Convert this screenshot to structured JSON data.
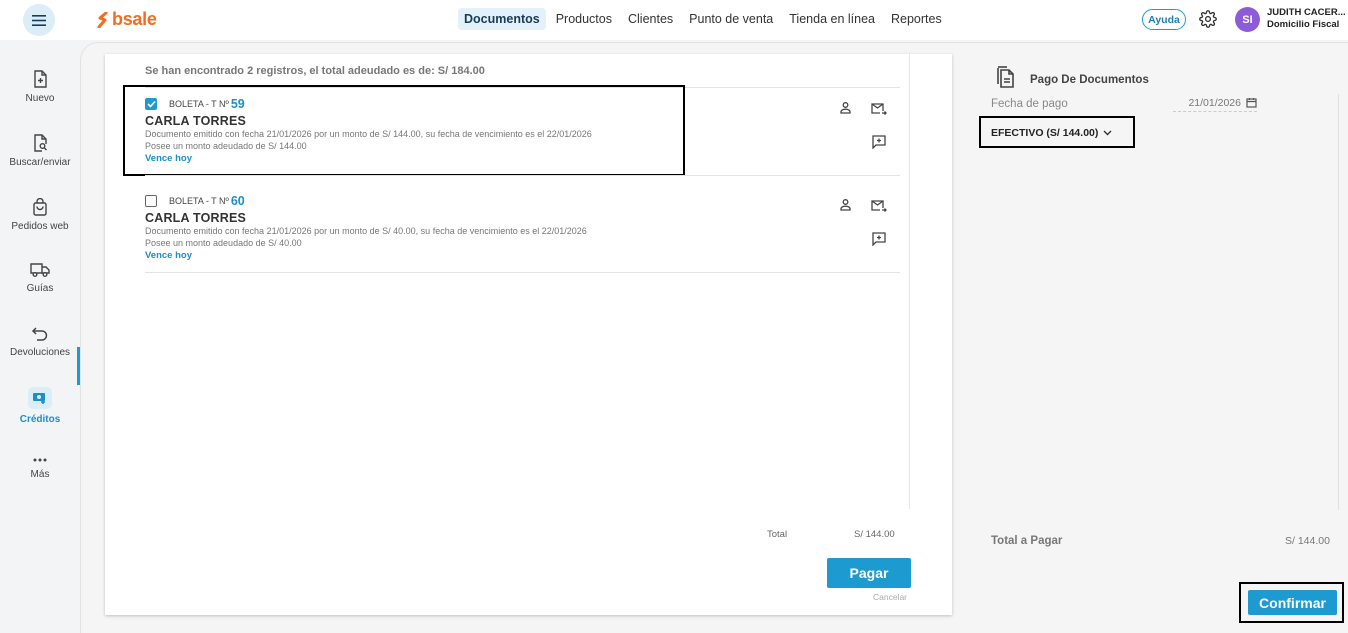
{
  "topbar": {
    "brand": "bsale",
    "nav": [
      "Documentos",
      "Productos",
      "Clientes",
      "Punto de venta",
      "Tienda en línea",
      "Reportes"
    ],
    "active_nav": "Documentos",
    "help_label": "Ayuda",
    "avatar_initials": "SI",
    "user_name": "JUDITH CACER...",
    "user_subtitle": "Domicilio Fiscal"
  },
  "sidebar": {
    "items": [
      {
        "label": "Nuevo",
        "icon": "new-document-icon"
      },
      {
        "label": "Buscar/enviar",
        "icon": "search-document-icon"
      },
      {
        "label": "Pedidos web",
        "icon": "shopping-bag-icon"
      },
      {
        "label": "Guías",
        "icon": "truck-icon"
      },
      {
        "label": "Devoluciones",
        "icon": "return-arrow-icon"
      },
      {
        "label": "Créditos",
        "icon": "credit-icon"
      },
      {
        "label": "Más",
        "icon": "more-dots-icon"
      }
    ],
    "active": "Créditos"
  },
  "documents": {
    "summary": "Se han encontrado 2 registros, el total adeudado es de: S/ 184.00",
    "items": [
      {
        "checked": true,
        "type": "BOLETA - T Nº",
        "number": "59",
        "client": "CARLA TORRES",
        "desc1": "Documento emitido con fecha 21/01/2026 por un monto de S/ 144.00, su fecha de vencimiento es el 22/01/2026",
        "desc2": "Posee un monto adeudado de S/ 144.00",
        "due": "Vence hoy"
      },
      {
        "checked": false,
        "type": "BOLETA - T Nº",
        "number": "60",
        "client": "CARLA TORRES",
        "desc1": "Documento emitido con fecha 21/01/2026 por un monto de S/ 40.00, su fecha de vencimiento es el 22/01/2026",
        "desc2": "Posee un monto adeudado de S/ 40.00",
        "due": "Vence hoy"
      }
    ],
    "total_label": "Total",
    "total_value": "S/ 144.00",
    "pay_button": "Pagar",
    "cancel_link": "Cancelar"
  },
  "payment": {
    "title": "Pago De Documentos",
    "date_label": "Fecha de pago",
    "date_value": "21/01/2026",
    "method": "EFECTIVO (S/ 144.00)",
    "total_label": "Total a Pagar",
    "total_value": "S/ 144.00",
    "confirm_button": "Confirmar"
  },
  "colors": {
    "accent": "#1d9bd1",
    "brand": "#f26d21",
    "avatar": "#8e5bd8"
  }
}
